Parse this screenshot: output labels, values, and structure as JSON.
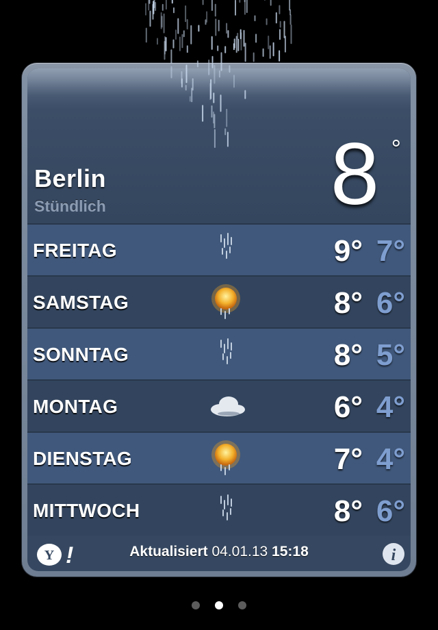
{
  "location": {
    "city": "Berlin",
    "subtitle": "Stündlich",
    "current_temp": "8",
    "degree_symbol": "°",
    "current_condition_icon": "rain-icon"
  },
  "forecast": [
    {
      "day": "FREITAG",
      "icon": "rain-icon",
      "high": "9°",
      "low": "7°"
    },
    {
      "day": "SAMSTAG",
      "icon": "sun-rain-icon",
      "high": "8°",
      "low": "6°"
    },
    {
      "day": "SONNTAG",
      "icon": "rain-icon",
      "high": "8°",
      "low": "5°"
    },
    {
      "day": "MONTAG",
      "icon": "cloud-icon",
      "high": "6°",
      "low": "4°"
    },
    {
      "day": "DIENSTAG",
      "icon": "sun-rain-icon",
      "high": "7°",
      "low": "4°"
    },
    {
      "day": "MITTWOCH",
      "icon": "rain-icon",
      "high": "8°",
      "low": "6°"
    }
  ],
  "footer": {
    "updated_label": "Aktualisiert",
    "updated_date": "04.01.13",
    "updated_time": "15:18",
    "provider_logo": "yahoo-logo",
    "info_icon": "info-icon"
  },
  "page_indicator": {
    "count": 3,
    "active_index": 1
  },
  "colors": {
    "background": "#000000",
    "panel": "#364861",
    "row_light": "#40587b",
    "row_dark": "#33455e",
    "low_temp": "#7f9ed0",
    "subtitle": "#8c9cb2"
  }
}
